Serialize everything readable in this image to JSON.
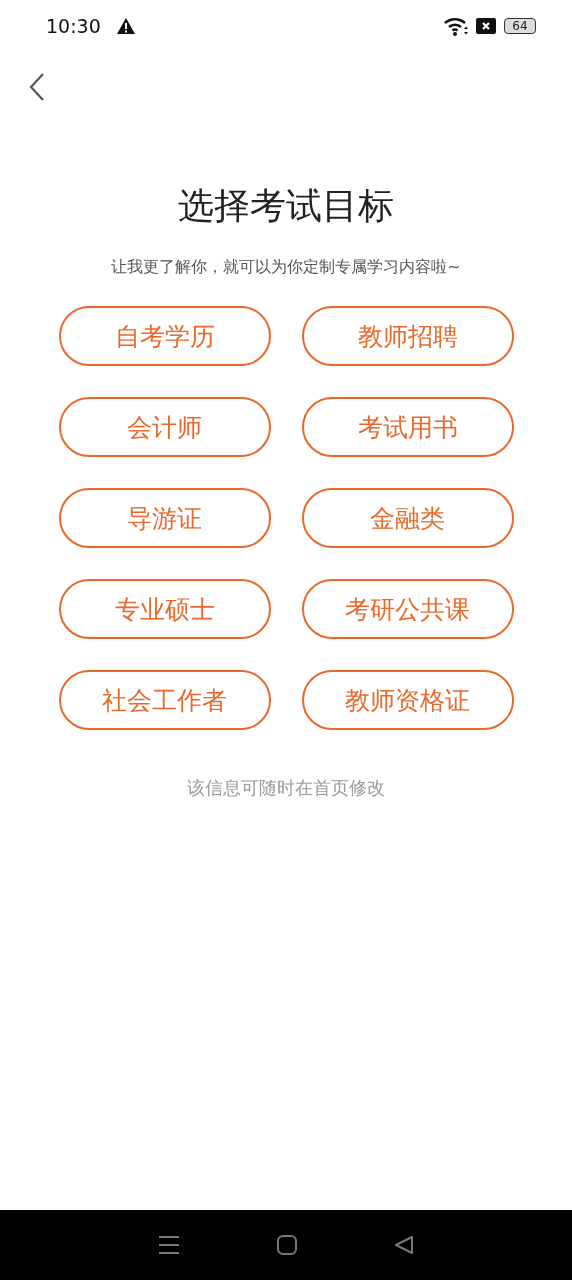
{
  "status_bar": {
    "time": "10:30",
    "battery": "64"
  },
  "title": "选择考试目标",
  "subtitle": "让我更了解你，就可以为你定制专属学习内容啦~",
  "options": [
    {
      "label": "自考学历",
      "selected": false
    },
    {
      "label": "教师招聘",
      "selected": false
    },
    {
      "label": "会计师",
      "selected": false
    },
    {
      "label": "考试用书",
      "selected": false
    },
    {
      "label": "导游证",
      "selected": false
    },
    {
      "label": "金融类",
      "selected": false
    },
    {
      "label": "专业硕士",
      "selected": false
    },
    {
      "label": "考研公共课",
      "selected": false
    },
    {
      "label": "社会工作者",
      "selected": false
    },
    {
      "label": "教师资格证",
      "selected": false
    }
  ],
  "note": "该信息可随时在首页修改"
}
